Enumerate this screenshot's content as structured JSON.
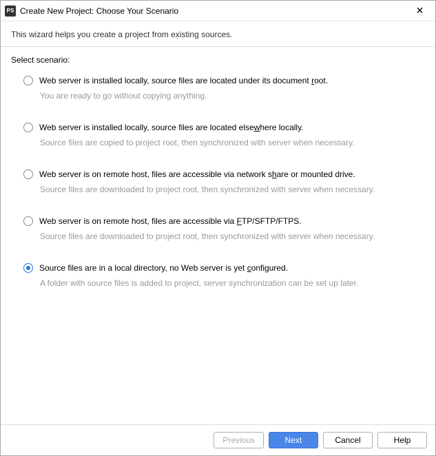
{
  "window": {
    "app_icon_text": "PS",
    "title": "Create New Project: Choose Your Scenario",
    "close_glyph": "✕"
  },
  "header": {
    "subtitle": "This wizard helps you create a project from existing sources."
  },
  "section_label": "Select scenario:",
  "options": [
    {
      "label_pre": "Web server is installed locally, source files are located under its document ",
      "mnemonic": "r",
      "label_post": "oot.",
      "desc": "You are ready to go without copying anything.",
      "selected": false
    },
    {
      "label_pre": "Web server is installed locally, source files are located else",
      "mnemonic": "w",
      "label_post": "here locally.",
      "desc": "Source files are copied to project root, then synchronized with server when necessary.",
      "selected": false
    },
    {
      "label_pre": "Web server is on remote host, files are accessible via network s",
      "mnemonic": "h",
      "label_post": "are or mounted drive.",
      "desc": "Source files are downloaded to project root, then synchronized with server when necessary.",
      "selected": false
    },
    {
      "label_pre": "Web server is on remote host, files are accessible via ",
      "mnemonic": "F",
      "label_post": "TP/SFTP/FTPS.",
      "desc": "Source files are downloaded to project root, then synchronized with server when necessary.",
      "selected": false
    },
    {
      "label_pre": "Source files are in a local directory, no Web server is yet ",
      "mnemonic": "c",
      "label_post": "onfigured.",
      "desc": "A folder with source files is added to project, server synchronization can be set up later.",
      "selected": true
    }
  ],
  "footer": {
    "previous": "Previous",
    "next": "Next",
    "cancel": "Cancel",
    "help": "Help"
  }
}
